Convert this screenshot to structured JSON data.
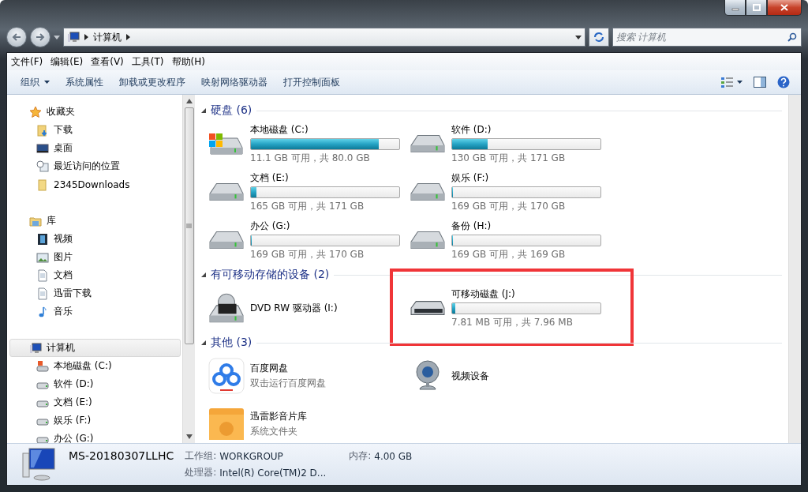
{
  "address": {
    "crumbs": [
      "计算机"
    ],
    "search_placeholder": "搜索 计算机"
  },
  "menu": [
    "文件(F)",
    "编辑(E)",
    "查看(V)",
    "工具(T)",
    "帮助(H)"
  ],
  "toolbar": [
    "组织",
    "系统属性",
    "卸载或更改程序",
    "映射网络驱动器",
    "打开控制面板"
  ],
  "sidebar": [
    {
      "label": "收藏夹",
      "kind": "star",
      "selected": false,
      "children": [
        {
          "label": "下载",
          "kind": "download",
          "selected": false
        },
        {
          "label": "桌面",
          "kind": "desktop",
          "selected": false
        },
        {
          "label": "最近访问的位置",
          "kind": "recent",
          "selected": false
        },
        {
          "label": "2345Downloads",
          "kind": "folder",
          "selected": false
        }
      ]
    },
    {
      "label": "库",
      "kind": "library",
      "selected": false,
      "children": [
        {
          "label": "视频",
          "kind": "video",
          "selected": false
        },
        {
          "label": "图片",
          "kind": "picture",
          "selected": false
        },
        {
          "label": "文档",
          "kind": "document",
          "selected": false
        },
        {
          "label": "迅雷下载",
          "kind": "document",
          "selected": false
        },
        {
          "label": "音乐",
          "kind": "music",
          "selected": false
        }
      ]
    },
    {
      "label": "计算机",
      "kind": "computer",
      "selected": true,
      "children": [
        {
          "label": "本地磁盘 (C:)",
          "kind": "system",
          "selected": false
        },
        {
          "label": "软件 (D:)",
          "kind": "drive",
          "selected": false
        },
        {
          "label": "文档 (E:)",
          "kind": "drive",
          "selected": false
        },
        {
          "label": "娱乐 (F:)",
          "kind": "drive",
          "selected": false
        },
        {
          "label": "办公 (G:)",
          "kind": "drive",
          "selected": false
        }
      ]
    }
  ],
  "sections": [
    {
      "title": "硬盘 (6)",
      "items": [
        {
          "kind": "system",
          "name": "本地磁盘 (C:)",
          "level": 0.86,
          "size": "11.1 GB 可用，共 80.0 GB",
          "highlight": false
        },
        {
          "kind": "hdd",
          "name": "软件 (D:)",
          "level": 0.24,
          "size": "130 GB 可用，共 171 GB",
          "highlight": false
        },
        {
          "kind": "hdd",
          "name": "文档 (E:)",
          "level": 0.035,
          "size": "165 GB 可用，共 171 GB",
          "highlight": false
        },
        {
          "kind": "hdd",
          "name": "娱乐 (F:)",
          "level": 0.006,
          "size": "169 GB 可用，共 170 GB",
          "highlight": false
        },
        {
          "kind": "hdd",
          "name": "办公 (G:)",
          "level": 0.006,
          "size": "169 GB 可用，共 170 GB",
          "highlight": false
        },
        {
          "kind": "hdd",
          "name": "备份 (H:)",
          "level": 0.006,
          "size": "169 GB 可用，共 169 GB",
          "highlight": false
        }
      ]
    },
    {
      "title": "有可移动存储的设备 (2)",
      "items": [
        {
          "kind": "dvd",
          "name": "DVD RW 驱动器 (I:)",
          "highlight": false
        },
        {
          "kind": "usb",
          "name": "可移动磁盘 (J:)",
          "level": 0.02,
          "size": "7.81 MB 可用，共 7.96 MB",
          "highlight": true
        }
      ]
    },
    {
      "title": "其他 (3)",
      "items": [
        {
          "kind": "cloud",
          "name": "百度网盘",
          "subtitle": "双击运行百度网盘",
          "highlight": false
        },
        {
          "kind": "webcam",
          "name": "视频设备",
          "highlight": false
        },
        {
          "kind": "library",
          "name": "迅雷影音片库",
          "subtitle": "系统文件夹",
          "highlight": false
        }
      ]
    }
  ],
  "details": {
    "name": "MS-20180307LLHC",
    "fields": [
      {
        "label": "工作组:",
        "value": "WORKGROUP"
      },
      {
        "label": "内存:",
        "value": "4.00 GB"
      },
      {
        "label": "处理器:",
        "value": "Intel(R) Core(TM)2 D..."
      }
    ]
  }
}
